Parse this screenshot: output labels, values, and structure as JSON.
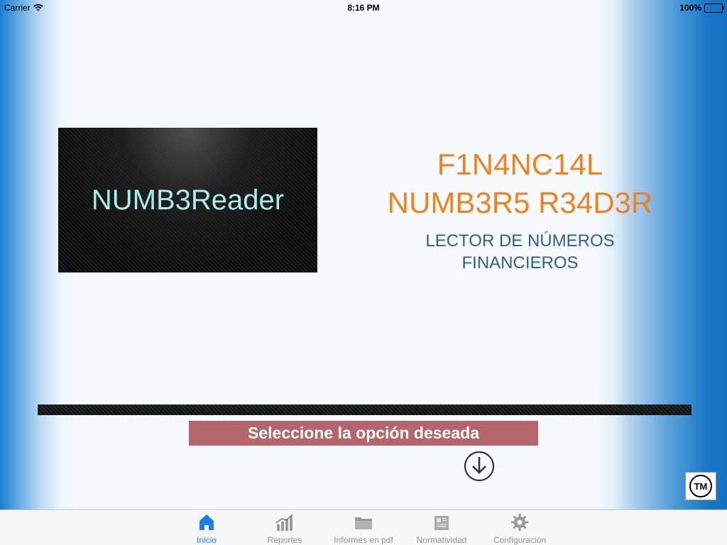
{
  "status_bar": {
    "carrier": "Carrier",
    "time": "8:16 PM",
    "battery": "100%"
  },
  "logo": {
    "text": "NUMB3Reader"
  },
  "title": {
    "line1": "F1N4NC14L",
    "line2": "NUMB3R5 R34D3R",
    "subtitle_line1": "LECTOR DE NÚMEROS",
    "subtitle_line2": "FINANCIEROS"
  },
  "banner": {
    "label": "Seleccione la opción deseada"
  },
  "badge": {
    "text": "TM"
  },
  "tab_bar": {
    "tabs": [
      {
        "label": "Inicio",
        "icon": "home-icon",
        "active": true
      },
      {
        "label": "Reportes",
        "icon": "bar-chart-icon",
        "active": false
      },
      {
        "label": "Informes en pdf",
        "icon": "folder-icon",
        "active": false
      },
      {
        "label": "Normatividad",
        "icon": "newspaper-icon",
        "active": false
      },
      {
        "label": "Configuración",
        "icon": "gear-icon",
        "active": false
      }
    ]
  },
  "colors": {
    "accent_blue": "#1a7cf0",
    "title_orange": "#f0821e",
    "subtitle_blue": "#2f5d95",
    "banner_red": "#b5666a",
    "logo_text": "#a8ecec"
  }
}
